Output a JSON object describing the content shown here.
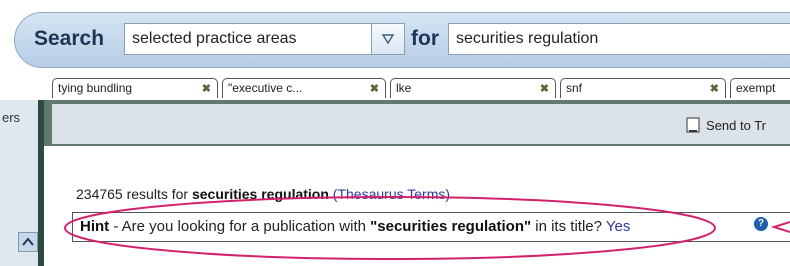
{
  "search": {
    "label": "Search",
    "scope_value": "selected practice areas",
    "for_label": "for",
    "query_value": "securities regulation"
  },
  "tabs": [
    {
      "label": "tying bundling"
    },
    {
      "label": "\"executive c..."
    },
    {
      "label": "lke"
    },
    {
      "label": "snf"
    },
    {
      "label": "exempt"
    }
  ],
  "left_rail": {
    "text": "ers"
  },
  "toolbar": {
    "send_label": "Send to Tr"
  },
  "results": {
    "count": "234765",
    "text": "results for",
    "query": "securities regulation",
    "thesaurus_link": "(Thesaurus Terms)"
  },
  "hint": {
    "prefix": "Hint",
    "before": " - Are you looking for a publication with ",
    "quoted": "\"securities regulation\"",
    "after": " in its title?",
    "yes_label": "Yes",
    "help_glyph": "?"
  },
  "colors": {
    "annotation": "#d2226b",
    "link": "#2d3a9a",
    "toolbar": "#617a6f"
  }
}
